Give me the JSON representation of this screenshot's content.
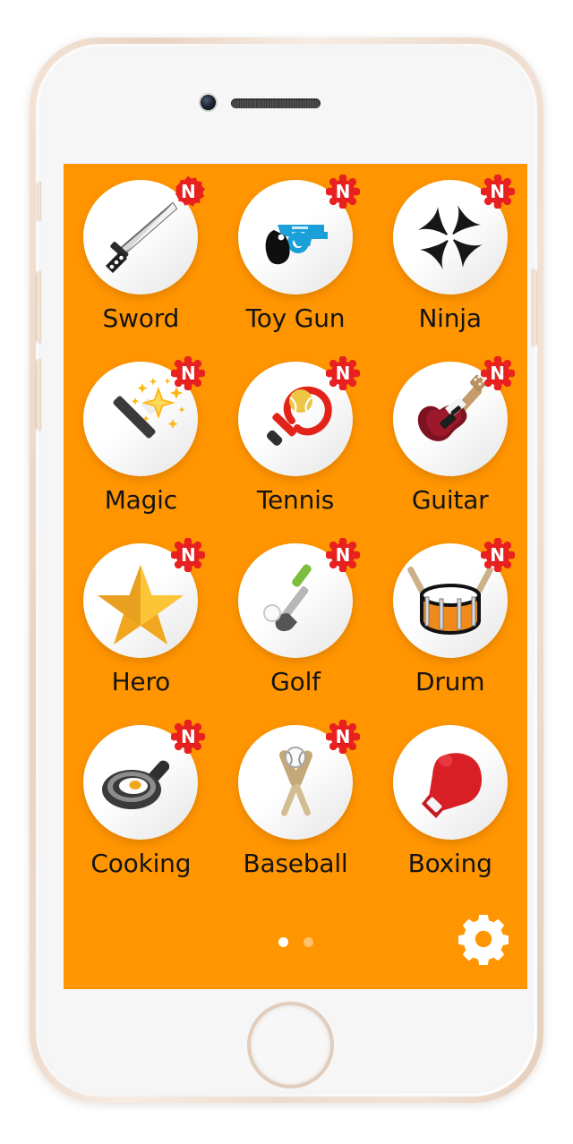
{
  "screen": {
    "background_color": "#ff9500",
    "badge_color": "#e8201f",
    "badge_text_color": "#ffffff",
    "label_color": "#141414"
  },
  "apps": [
    {
      "label": "Sword",
      "icon": "katana-sword-icon",
      "badge": "N",
      "has_badge": true
    },
    {
      "label": "Toy Gun",
      "icon": "toy-revolver-icon",
      "badge": "N",
      "has_badge": true
    },
    {
      "label": "Ninja",
      "icon": "ninja-shuriken-icon",
      "badge": "N",
      "has_badge": true
    },
    {
      "label": "Magic",
      "icon": "magic-wand-icon",
      "badge": "N",
      "has_badge": true
    },
    {
      "label": "Tennis",
      "icon": "tennis-racket-icon",
      "badge": "N",
      "has_badge": true
    },
    {
      "label": "Guitar",
      "icon": "electric-guitar-icon",
      "badge": "N",
      "has_badge": true
    },
    {
      "label": "Hero",
      "icon": "gold-star-icon",
      "badge": "N",
      "has_badge": true
    },
    {
      "label": "Golf",
      "icon": "golf-club-ball-icon",
      "badge": "N",
      "has_badge": true
    },
    {
      "label": "Drum",
      "icon": "snare-drum-icon",
      "badge": "N",
      "has_badge": true
    },
    {
      "label": "Cooking",
      "icon": "frying-pan-egg-icon",
      "badge": "N",
      "has_badge": true
    },
    {
      "label": "Baseball",
      "icon": "baseball-bats-icon",
      "badge": "N",
      "has_badge": true
    },
    {
      "label": "Boxing",
      "icon": "boxing-glove-icon",
      "badge": "",
      "has_badge": false
    }
  ],
  "bottom_bar": {
    "pages": [
      {
        "name": "page-1",
        "active": true
      },
      {
        "name": "page-2",
        "active": false
      }
    ],
    "settings_icon": "gear-icon"
  },
  "device": {
    "camera": "front-camera",
    "speaker": "earpiece-speaker",
    "home_button": "home-button",
    "buttons": [
      "silent-switch",
      "volume-up-button",
      "volume-down-button",
      "power-button"
    ]
  }
}
